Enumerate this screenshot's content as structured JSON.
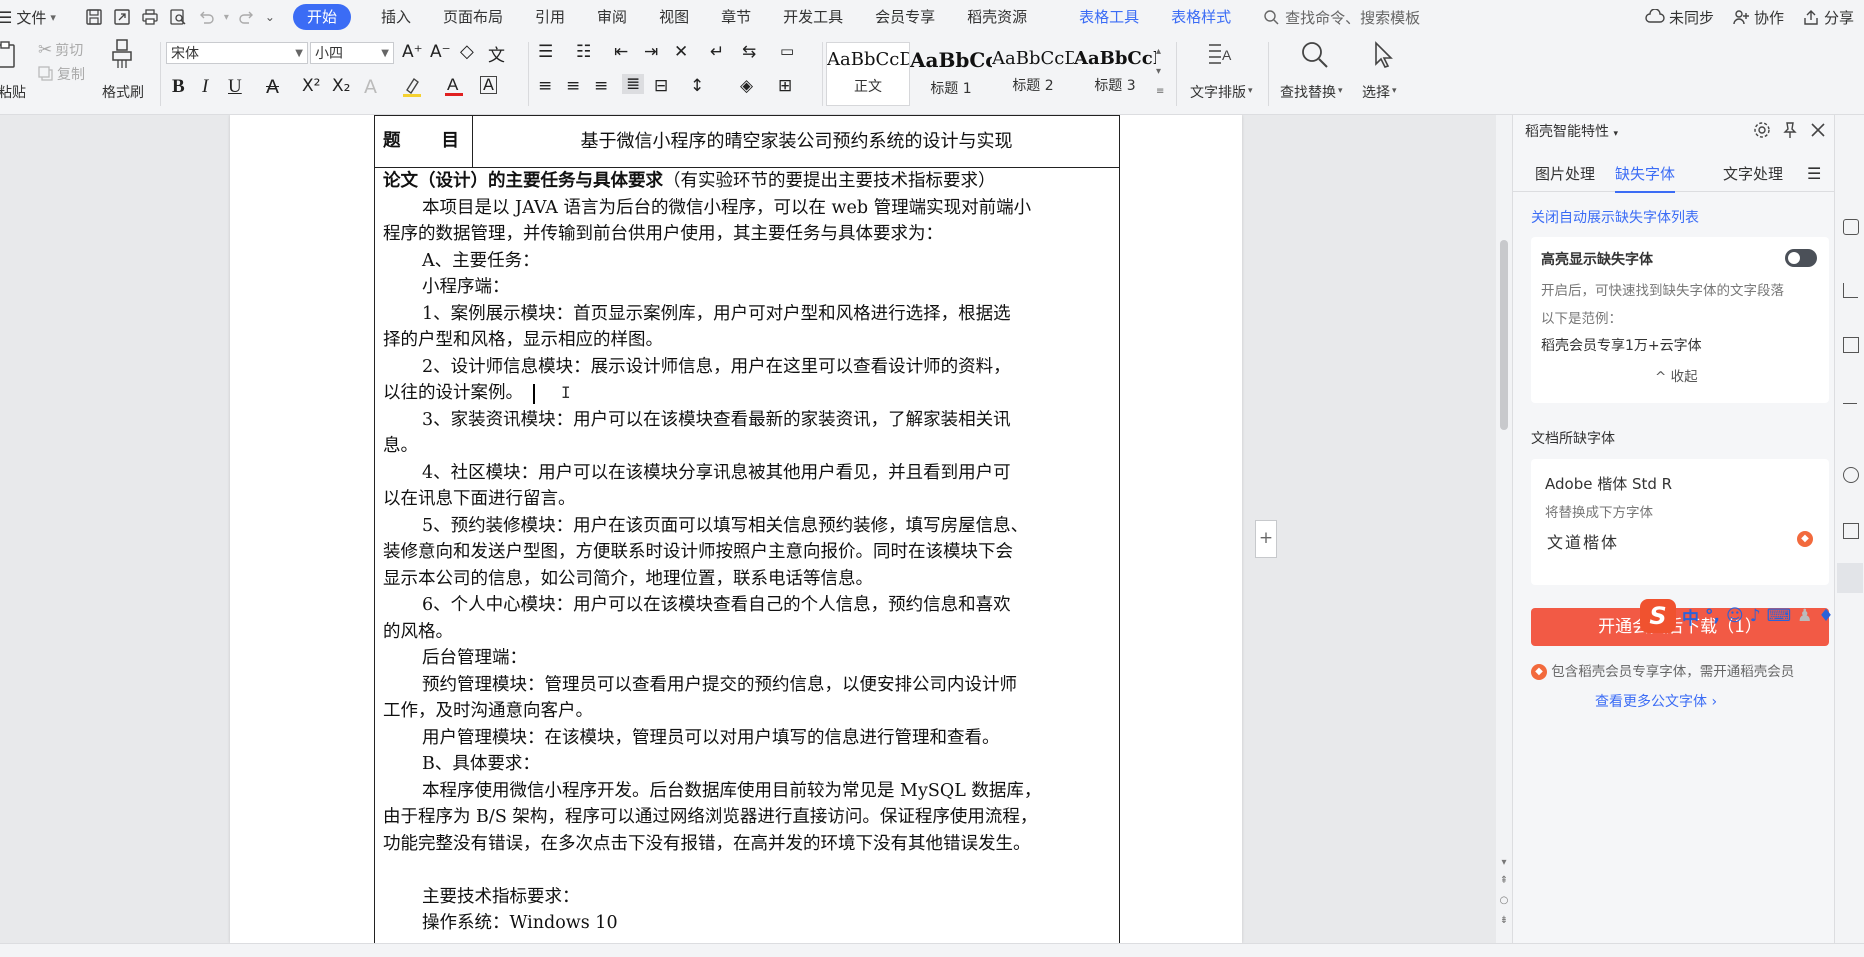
{
  "menubar": {
    "file_label": "文件",
    "tabs": [
      {
        "label": "开始",
        "active": true
      },
      {
        "label": "插入"
      },
      {
        "label": "页面布局"
      },
      {
        "label": "引用"
      },
      {
        "label": "审阅"
      },
      {
        "label": "视图"
      },
      {
        "label": "章节"
      },
      {
        "label": "开发工具"
      },
      {
        "label": "会员专享"
      },
      {
        "label": "稻壳资源"
      },
      {
        "label": "表格工具",
        "context": true
      },
      {
        "label": "表格样式",
        "context": true
      }
    ],
    "search_placeholder": "查找命令、搜索模板",
    "sync_label": "未同步",
    "collab_label": "协作",
    "share_label": "分享"
  },
  "ribbon": {
    "paste_label": "粘贴",
    "cut_label": "剪切",
    "copy_label": "复制",
    "format_painter_label": "格式刷",
    "font_name": "宋体",
    "font_size": "小四",
    "styles": [
      {
        "sample": "AaBbCcD",
        "name": "正文"
      },
      {
        "sample": "AaBbCc",
        "name": "标题 1"
      },
      {
        "sample": "AaBbCcD",
        "name": "标题 2"
      },
      {
        "sample": "AaBbCcD",
        "name": "标题 3"
      }
    ],
    "text_layout_label": "文字排版",
    "find_replace_label": "查找替换",
    "select_label": "选择"
  },
  "document": {
    "title_label": "题　　目",
    "title_value": "基于微信小程序的晴空家装公司预约系统的设计与实现",
    "heading_bold": "论文（设计）的主要任务与具体要求",
    "heading_note": "（有实验环节的要提出主要技术指标要求）",
    "lines": [
      {
        "text": "本项目是以 JAVA 语言为后台的微信小程序，可以在 web 管理端实现对前端小",
        "indent": true
      },
      {
        "text": "程序的数据管理，并传输到前台供用户使用，其主要任务与具体要求为：",
        "indent": false
      },
      {
        "text": "A、主要任务：",
        "indent": true
      },
      {
        "text": "小程序端：",
        "indent": true
      },
      {
        "text": "1、案例展示模块：首页显示案例库，用户可对户型和风格进行选择，根据选",
        "indent": true
      },
      {
        "text": "择的户型和风格，显示相应的样图。",
        "indent": false
      },
      {
        "text": "2、设计师信息模块：展示设计师信息，用户在这里可以查看设计师的资料，",
        "indent": true
      },
      {
        "text": "以往的设计案例。",
        "indent": false,
        "cursor": true
      },
      {
        "text": "3、家装资讯模块：用户可以在该模块查看最新的家装资讯，了解家装相关讯",
        "indent": true
      },
      {
        "text": "息。",
        "indent": false
      },
      {
        "text": "4、社区模块：用户可以在该模块分享讯息被其他用户看见，并且看到用户可",
        "indent": true
      },
      {
        "text": "以在讯息下面进行留言。",
        "indent": false
      },
      {
        "text": "5、预约装修模块：用户在该页面可以填写相关信息预约装修，填写房屋信息、",
        "indent": true
      },
      {
        "text": "装修意向和发送户型图，方便联系时设计师按照户主意向报价。同时在该模块下会",
        "indent": false
      },
      {
        "text": "显示本公司的信息，如公司简介，地理位置，联系电话等信息。",
        "indent": false
      },
      {
        "text": "6、个人中心模块：用户可以在该模块查看自己的个人信息，预约信息和喜欢",
        "indent": true
      },
      {
        "text": "的风格。",
        "indent": false
      },
      {
        "text": "后台管理端：",
        "indent": true
      },
      {
        "text": "预约管理模块：管理员可以查看用户提交的预约信息，以便安排公司内设计师",
        "indent": true
      },
      {
        "text": "工作，及时沟通意向客户。",
        "indent": false
      },
      {
        "text": "用户管理模块：在该模块，管理员可以对用户填写的信息进行管理和查看。",
        "indent": true
      },
      {
        "text": "B、具体要求：",
        "indent": true
      },
      {
        "text": "本程序使用微信小程序开发。后台数据库使用目前较为常见是 MySQL 数据库，",
        "indent": true
      },
      {
        "text": "由于程序为 B/S 架构，程序可以通过网络浏览器进行直接访问。保证程序使用流程，",
        "indent": false
      },
      {
        "text": "功能完整没有错误，在多次点击下没有报错，在高并发的环境下没有其他错误发生。",
        "indent": false
      },
      {
        "text": "",
        "indent": false
      },
      {
        "text": "主要技术指标要求：",
        "indent": true
      },
      {
        "text": "操作系统：Windows 10",
        "indent": true
      }
    ]
  },
  "panel": {
    "header": "稻壳智能特性",
    "tabs": [
      "图片处理",
      "缺失字体",
      "文字处理"
    ],
    "active_tab": "缺失字体",
    "close_auto_link": "关闭自动展示缺失字体列表",
    "highlight_title": "高亮显示缺失字体",
    "highlight_desc": "开启后，可快速找到缺失字体的文字段落",
    "example_label": "以下是范例：",
    "example_value": "稻壳会员专享1万+云字体",
    "collapse_label": "收起",
    "missing_section": "文档所缺字体",
    "missing_font": "Adobe 楷体 Std R",
    "replace_hint": "将替换成下方字体",
    "replacement_font": "文道楷体",
    "open_button": "开通会员后下载（1）",
    "member_note": "包含稻壳会员专享字体，需开通稻壳会员",
    "more_link": "查看更多公文字体"
  },
  "ime": {
    "lang": "中"
  },
  "colors": {
    "accent": "#3b6cf5",
    "member_red": "#f25a45",
    "ime_orange": "#f0522f"
  }
}
